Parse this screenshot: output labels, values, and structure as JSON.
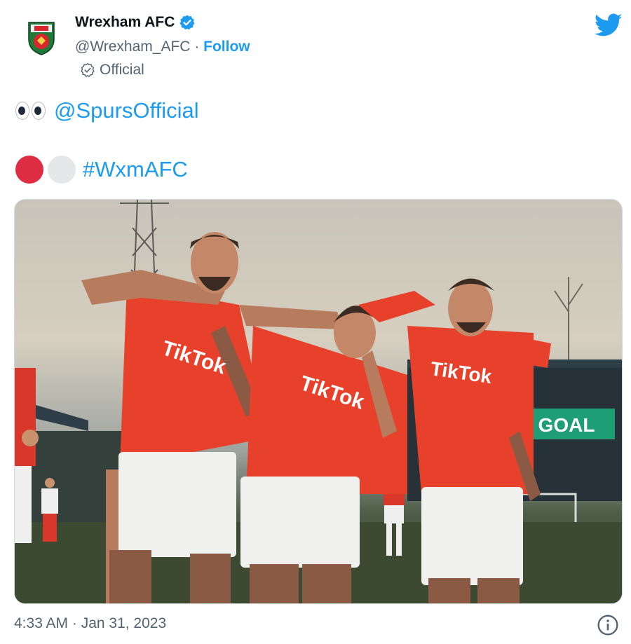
{
  "author": {
    "display_name": "Wrexham AFC",
    "handle": "@Wrexham_AFC",
    "separator": "·",
    "follow_label": "Follow",
    "label": "Official",
    "verified": true
  },
  "tweet": {
    "mention": "@SpursOfficial",
    "hashtag": "#WxmAFC",
    "circle_colors": [
      "#dd2e44",
      "#e6e7e8"
    ],
    "media_text": {
      "jersey_sponsor": "TikTok",
      "board": "GOAL"
    }
  },
  "footer": {
    "timestamp": "4:33 AM · Jan 31, 2023"
  },
  "colors": {
    "link": "#1d9bf0",
    "secondary_text": "#536471",
    "kit_red": "#e8412b",
    "goal_board": "#1e9e74"
  },
  "icons": [
    "crest-icon",
    "verified-badge-icon",
    "official-check-icon",
    "twitter-bird-icon",
    "eyes-emoji-icon",
    "info-icon"
  ]
}
